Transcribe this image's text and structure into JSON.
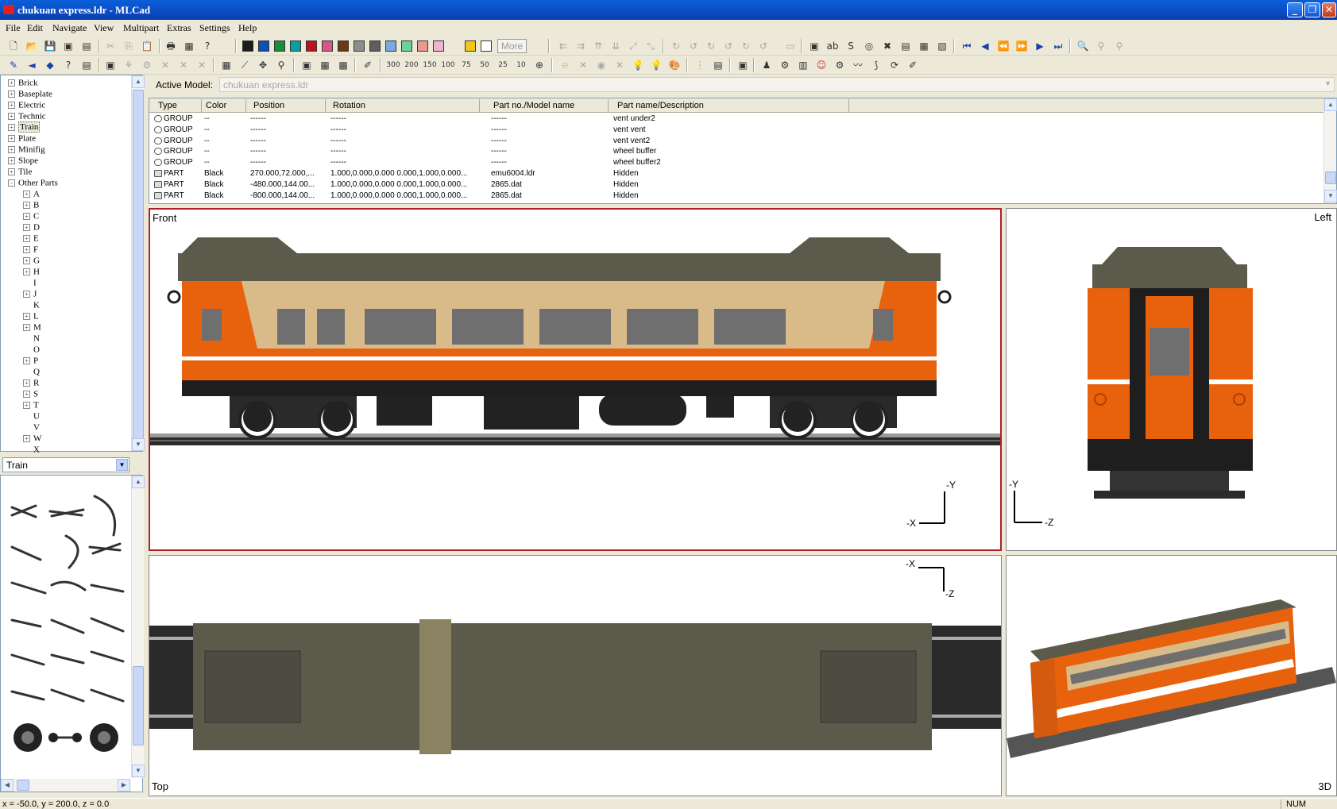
{
  "window": {
    "title": "chukuan express.ldr - MLCad",
    "minimize": "_",
    "maximize": "❐",
    "close": "✕"
  },
  "menu": [
    "File",
    "Edit",
    "Navigate",
    "View",
    "Multipart",
    "Extras",
    "Settings",
    "Help"
  ],
  "toolbar": {
    "more_label": "More",
    "colors": [
      "#1b1b1b",
      "#0b52b5",
      "#1a8c3a",
      "#0a9ea4",
      "#c0101c",
      "#d9568a",
      "#6b3a12",
      "#8d8d8d",
      "#5e5e5e",
      "#79a9e0",
      "#6ed09c",
      "#e99a8e",
      "#f0b3d0",
      "#f2c713",
      "#ffffff"
    ]
  },
  "categories": {
    "top": [
      "Brick",
      "Baseplate",
      "Electric",
      "Technic",
      "Train",
      "Plate",
      "Minifig",
      "Slope",
      "Tile",
      "Other Parts"
    ],
    "selected": "Train",
    "letters": [
      "A",
      "B",
      "C",
      "D",
      "E",
      "F",
      "G",
      "H",
      "I",
      "J",
      "K",
      "L",
      "M",
      "N",
      "O",
      "P",
      "Q",
      "R",
      "S",
      "T",
      "U",
      "V",
      "W",
      "X"
    ]
  },
  "parts_filter": "Train",
  "active_model": {
    "label": "Active Model:",
    "value": "chukuan express.ldr"
  },
  "table": {
    "headers": [
      "Type",
      "Color",
      "Position",
      "Rotation",
      "Part no./Model name",
      "Part name/Description"
    ],
    "rows": [
      {
        "type": "GROUP",
        "color": "--",
        "position": "------",
        "rotation": "------",
        "part": "------",
        "desc": "vent under2"
      },
      {
        "type": "GROUP",
        "color": "--",
        "position": "------",
        "rotation": "------",
        "part": "------",
        "desc": "vent vent"
      },
      {
        "type": "GROUP",
        "color": "--",
        "position": "------",
        "rotation": "------",
        "part": "------",
        "desc": "vent vent2"
      },
      {
        "type": "GROUP",
        "color": "--",
        "position": "------",
        "rotation": "------",
        "part": "------",
        "desc": "wheel buffer"
      },
      {
        "type": "GROUP",
        "color": "--",
        "position": "------",
        "rotation": "------",
        "part": "------",
        "desc": "wheel buffer2"
      },
      {
        "type": "PART",
        "color": "Black",
        "position": "270.000,72.000,...",
        "rotation": "1.000,0.000,0.000 0.000,1.000,0.000...",
        "part": "emu6004.ldr",
        "desc": "Hidden"
      },
      {
        "type": "PART",
        "color": "Black",
        "position": "-480.000,144.00...",
        "rotation": "1.000,0.000,0.000 0.000,1.000,0.000...",
        "part": "2865.dat",
        "desc": "Hidden"
      },
      {
        "type": "PART",
        "color": "Black",
        "position": "-800.000,144.00...",
        "rotation": "1.000,0.000,0.000 0.000,1.000,0.000...",
        "part": "2865.dat",
        "desc": "Hidden"
      }
    ]
  },
  "views": {
    "front": {
      "label": "Front",
      "axis_v": "-Y",
      "axis_h": "-X"
    },
    "left": {
      "label": "Left",
      "axis_v": "-Y",
      "axis_h": "-Z"
    },
    "top": {
      "label": "Top",
      "axis_h": "-X",
      "axis_v": "-Z"
    },
    "three_d": {
      "label": "3D"
    }
  },
  "status": {
    "coords": "x = -50.0, y = 200.0, z = 0.0",
    "num": "NUM"
  },
  "colors": {
    "orange": "#e8620e",
    "tan": "#d9bb8a",
    "roof": "#5c5a4a",
    "dark": "#1f1f1f",
    "window": "#6f6f6f"
  }
}
